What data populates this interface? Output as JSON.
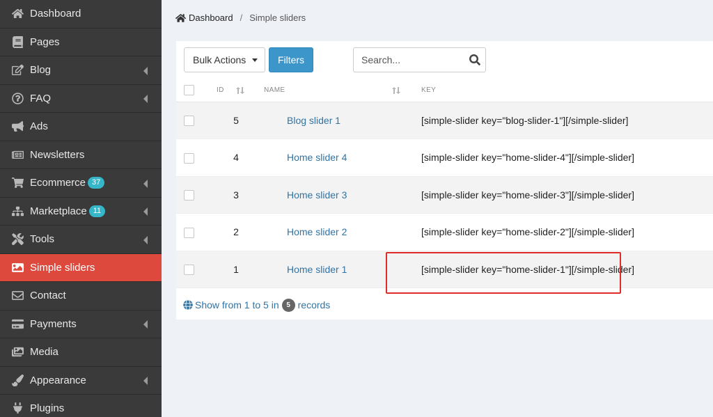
{
  "sidebar": {
    "items": [
      {
        "label": "Dashboard",
        "icon": "home-icon"
      },
      {
        "label": "Pages",
        "icon": "book-icon"
      },
      {
        "label": "Blog",
        "icon": "edit-icon",
        "has_chevron": true
      },
      {
        "label": "FAQ",
        "icon": "question-circle-icon",
        "has_chevron": true
      },
      {
        "label": "Ads",
        "icon": "bullhorn-icon"
      },
      {
        "label": "Newsletters",
        "icon": "newspaper-icon"
      },
      {
        "label": "Ecommerce",
        "icon": "shopping-cart-icon",
        "badge": "37",
        "has_chevron": true
      },
      {
        "label": "Marketplace",
        "icon": "sitemap-icon",
        "badge": "11",
        "has_chevron": true
      },
      {
        "label": "Tools",
        "icon": "tools-icon",
        "has_chevron": true
      },
      {
        "label": "Simple sliders",
        "icon": "image-icon",
        "active": true
      },
      {
        "label": "Contact",
        "icon": "envelope-icon"
      },
      {
        "label": "Payments",
        "icon": "credit-card-icon",
        "has_chevron": true
      },
      {
        "label": "Media",
        "icon": "images-icon"
      },
      {
        "label": "Appearance",
        "icon": "paint-brush-icon",
        "has_chevron": true
      },
      {
        "label": "Plugins",
        "icon": "plug-icon"
      }
    ],
    "active_color": "#dd4a3d",
    "badge_color": "#36b6c9"
  },
  "breadcrumb": {
    "home": "Dashboard",
    "current": "Simple sliders"
  },
  "toolbar": {
    "bulk_actions": "Bulk Actions",
    "filters": "Filters",
    "search_placeholder": "Search...",
    "filters_color": "#3d96c9"
  },
  "table": {
    "headers": {
      "id": "ID",
      "name": "NAME",
      "key": "KEY"
    },
    "rows": [
      {
        "id": "5",
        "name": "Blog slider 1",
        "key": "[simple-slider key=\"blog-slider-1\"][/simple-slider]"
      },
      {
        "id": "4",
        "name": "Home slider 4",
        "key": "[simple-slider key=\"home-slider-4\"][/simple-slider]"
      },
      {
        "id": "3",
        "name": "Home slider 3",
        "key": "[simple-slider key=\"home-slider-3\"][/simple-slider]"
      },
      {
        "id": "2",
        "name": "Home slider 2",
        "key": "[simple-slider key=\"home-slider-2\"][/simple-slider]"
      },
      {
        "id": "1",
        "name": "Home slider 1",
        "key": "[simple-slider key=\"home-slider-1\"][/simple-slider]"
      }
    ]
  },
  "footer": {
    "text_before": "Show from 1 to 5 in",
    "count": "5",
    "text_after": "records"
  },
  "highlight_color": "#e02b2b"
}
